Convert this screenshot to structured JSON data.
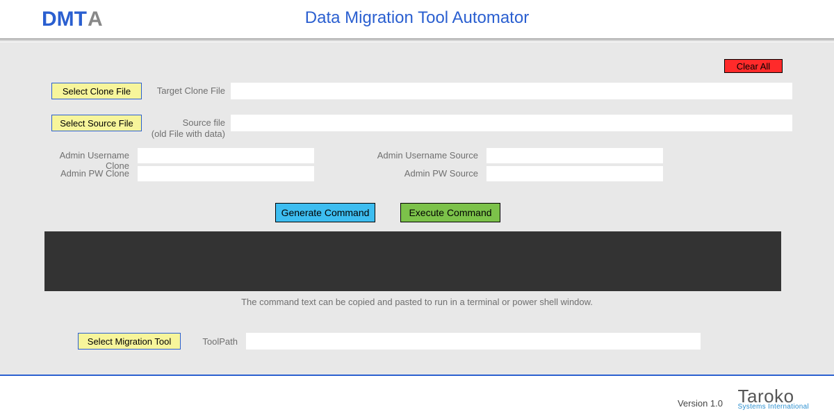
{
  "header": {
    "logo_main": "DMT",
    "logo_accent": "A",
    "title": "Data Migration Tool Automator"
  },
  "buttons": {
    "clear_all": "Clear All",
    "select_clone": "Select Clone File",
    "select_source": "Select Source File",
    "generate": "Generate Command",
    "execute": "Execute Command",
    "select_tool": "Select Migration Tool"
  },
  "labels": {
    "target_clone": "Target Clone File",
    "source_line1": "Source file",
    "source_line2": "(old File with data)",
    "admin_user_clone": "Admin Username Clone",
    "admin_pw_clone": "Admin PW Clone",
    "admin_user_source": "Admin Username Source",
    "admin_pw_source": "Admin PW Source",
    "toolpath": "ToolPath"
  },
  "values": {
    "clone_file": "",
    "source_file": "",
    "admin_user_clone": "",
    "admin_pw_clone": "",
    "admin_user_source": "",
    "admin_pw_source": "",
    "command_output": "",
    "tool_path": ""
  },
  "hint": "The command text can be copied and pasted to run in a terminal or power shell window.",
  "footer": {
    "version": "Version 1.0",
    "company": "Taroko",
    "tagline": "Systems International"
  }
}
